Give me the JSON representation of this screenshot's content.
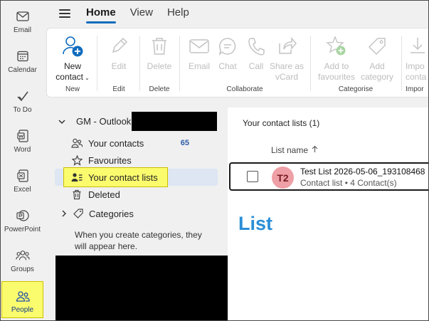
{
  "rail": {
    "items": [
      {
        "label": "Email",
        "icon": "mail-icon"
      },
      {
        "label": "Calendar",
        "icon": "calendar-icon"
      },
      {
        "label": "To Do",
        "icon": "checkmark-icon"
      },
      {
        "label": "Word",
        "icon": "word-icon"
      },
      {
        "label": "Excel",
        "icon": "excel-icon"
      },
      {
        "label": "PowerPoint",
        "icon": "powerpoint-icon"
      },
      {
        "label": "Groups",
        "icon": "groups-icon"
      },
      {
        "label": "People",
        "icon": "people-icon"
      }
    ],
    "active_color": "#fbfb6e"
  },
  "tabs": [
    {
      "label": "Home",
      "active": true
    },
    {
      "label": "View",
      "active": false
    },
    {
      "label": "Help",
      "active": false
    }
  ],
  "ribbon": {
    "new_contact_line1": "New",
    "new_contact_line2": "contact",
    "edit": "Edit",
    "delete": "Delete",
    "email": "Email",
    "chat": "Chat",
    "call": "Call",
    "share_line1": "Share as",
    "share_line2": "vCard",
    "fav_line1": "Add to",
    "fav_line2": "favourites",
    "cat_line1": "Add",
    "cat_line2": "category",
    "import_line1": "Impo",
    "import_line2": "conta",
    "groups": {
      "new": "New",
      "edit": "Edit",
      "delete": "Delete",
      "collaborate": "Collaborate",
      "categorise": "Categorise",
      "import": "Impor"
    }
  },
  "folders": {
    "account": "GM - Outlook",
    "items": [
      {
        "label": "Your contacts",
        "count": "65",
        "icon": "contacts-icon"
      },
      {
        "label": "Favourites",
        "icon": "star-icon"
      },
      {
        "label": "Your contact lists",
        "icon": "contact-list-icon",
        "selected": true
      },
      {
        "label": "Deleted",
        "icon": "trash-icon"
      }
    ],
    "categories_label": "Categories",
    "categories_hint": "When you create categories, they will appear here."
  },
  "main": {
    "title": "Your contact lists (1)",
    "column_header": "List name",
    "row": {
      "initials": "T2",
      "name": "Test List 2026-05-06_193108468",
      "subtitle": "Contact list • 4 Contact(s)"
    },
    "annotation": "List",
    "accent_color": "#0f6cbd"
  }
}
